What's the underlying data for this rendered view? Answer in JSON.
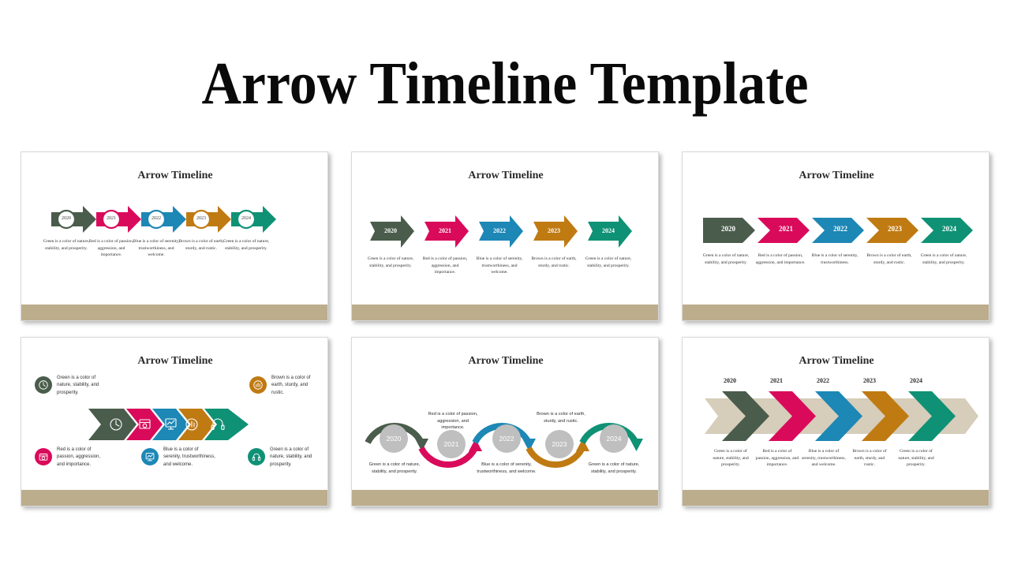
{
  "page": {
    "title": "Arrow Timeline Template",
    "background": "#ffffff"
  },
  "palette": {
    "green_dark": "#4a5c4b",
    "pink": "#da0a5b",
    "blue": "#1d87b5",
    "brown": "#c07a12",
    "teal": "#0f9175",
    "beige_footer": "#bcad8d",
    "beige_band": "#d6cdba",
    "gray_circle": "#bfbfbf",
    "title_text": "#2b2b2b",
    "caption_text": "#2f2f2f"
  },
  "steps": [
    {
      "year": "2020",
      "color": "#4a5c4b",
      "icon": "clock-icon",
      "caption": "Green is a color of nature, stability, and prosperity."
    },
    {
      "year": "2021",
      "color": "#da0a5b",
      "icon": "camera-calendar-icon",
      "caption": "Red is a color of passion, aggression, and importance."
    },
    {
      "year": "2022",
      "color": "#1d87b5",
      "icon": "presentation-chart-icon",
      "caption": "Blue is a color of serenity, trustworthiness, and welcome."
    },
    {
      "year": "2023",
      "color": "#c07a12",
      "icon": "growth-pie-icon",
      "caption": "Brown is a color of earth, sturdy, and rustic."
    },
    {
      "year": "2024",
      "color": "#0f9175",
      "icon": "headset-icon",
      "caption": "Green is a color of nature, stability, and prosperity."
    }
  ],
  "slides": [
    {
      "id": "slide-1",
      "title": "Arrow Timeline",
      "style": "arrow-with-rings",
      "captions": [
        "Green is a color of nature, stability, and prosperity.",
        "Red is a color of passion, aggression, and importance.",
        "Blue is a color of serenity, trustworthiness, and welcome.",
        "Brown is a color of earth, sturdy, and rustic.",
        "Green is a color of nature, stability, and prosperity."
      ]
    },
    {
      "id": "slide-2",
      "title": "Arrow Timeline",
      "style": "separate-notched-arrows",
      "captions": [
        "Green is a color of nature, stability, and prosperity.",
        "Red is a color of passion, aggression, and importance.",
        "Blue is a color of serenity, trustworthiness, and welcome.",
        "Brown is a color of earth, sturdy, and rustic.",
        "Green is a color of nature, stability, and prosperity."
      ]
    },
    {
      "id": "slide-3",
      "title": "Arrow Timeline",
      "style": "chevron-blocks",
      "captions": [
        "Green is a color of nature, stability, and prosperity.",
        "Red is a color of passion, aggression, and importance.",
        "Blue is a color of serenity, trustworthiness.",
        "Brown is a color of earth, sturdy, and rustic.",
        "Green is a color of nature, stability, and prosperity."
      ]
    },
    {
      "id": "slide-4",
      "title": "Arrow Timeline",
      "style": "icon-arrows",
      "captions": [
        "Green is a color of nature, stability, and prosperity.",
        "Red is a color of passion, aggression, and importance.",
        "Blue is a color of serenity, trustworthiness, and welcome.",
        "Brown is a color of earth, sturdy, and rustic.",
        "Green is a color of nature, stability, and prosperity."
      ]
    },
    {
      "id": "slide-5",
      "title": "Arrow Timeline",
      "style": "s-curve-arrows",
      "captions": [
        "Green is a color of nature, stability, and prosperity.",
        "Red is a color of passion, aggression, and importance.",
        "Blue is a color of serenity, trustworthiness, and welcome.",
        "Brown is a color of earth, sturdy, and rustic.",
        "Green is a color of nature, stability, and prosperity."
      ]
    },
    {
      "id": "slide-6",
      "title": "Arrow Timeline",
      "style": "chevrons-on-band",
      "captions": [
        "Green is a color of nature, stability, and prosperity.",
        "Red is a color of passion, aggression, and importance.",
        "Blue is a color of serenity, trustworthiness, and welcome.",
        "Brown is a color of earth, sturdy, and rustic.",
        "Green is a color of nature, stability, and prosperity."
      ]
    }
  ]
}
